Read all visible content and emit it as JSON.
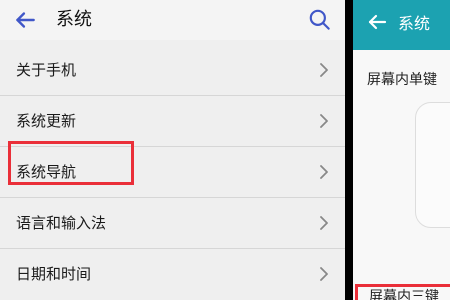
{
  "left_panel": {
    "title": "系统",
    "items": [
      {
        "label": "关于手机"
      },
      {
        "label": "系统更新"
      },
      {
        "label": "系统导航"
      },
      {
        "label": "语言和输入法"
      },
      {
        "label": "日期和时间"
      }
    ],
    "highlighted_item": "系统导航",
    "icons": {
      "back": "arrow-left-icon",
      "search": "search-icon",
      "chevron": "chevron-right-icon"
    }
  },
  "right_panel": {
    "title": "系统",
    "option_label": "屏幕内单键",
    "option_label_2": "屏幕内三键",
    "icons": {
      "back": "arrow-left-icon"
    }
  },
  "colors": {
    "header_bg": "#f4f4f4",
    "left_bg": "#efefef",
    "accent_blue": "#4057c8",
    "right_header": "#1ca2b1",
    "highlight_red": "#ea2f39",
    "divider": "#000000"
  }
}
